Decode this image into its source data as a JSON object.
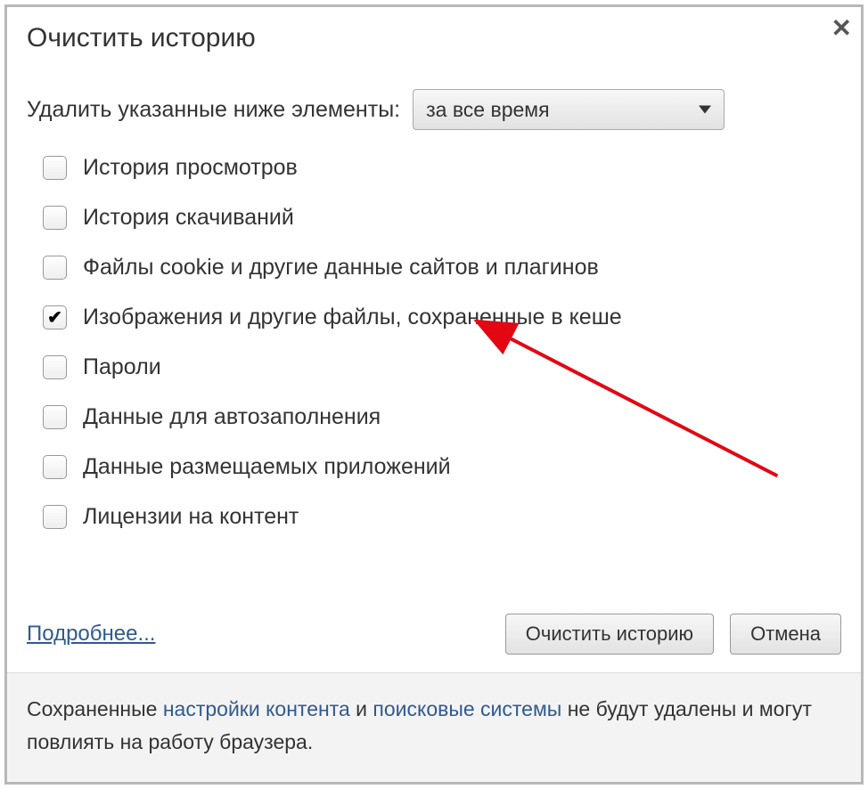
{
  "title": "Очистить историю",
  "prompt": "Удалить указанные ниже элементы:",
  "dropdown_value": "за все время",
  "options": [
    {
      "label": "История просмотров",
      "checked": false
    },
    {
      "label": "История скачиваний",
      "checked": false
    },
    {
      "label": "Файлы cookie и другие данные сайтов и плагинов",
      "checked": false
    },
    {
      "label": "Изображения и другие файлы, сохраненные в кеше",
      "checked": true
    },
    {
      "label": "Пароли",
      "checked": false
    },
    {
      "label": "Данные для автозаполнения",
      "checked": false
    },
    {
      "label": "Данные размещаемых приложений",
      "checked": false
    },
    {
      "label": "Лицензии на контент",
      "checked": false
    }
  ],
  "more_link": "Подробнее...",
  "clear_button": "Очистить историю",
  "cancel_button": "Отмена",
  "info_prefix": "Сохраненные ",
  "info_link1": "настройки контента",
  "info_mid": " и ",
  "info_link2": "поисковые системы",
  "info_suffix": " не будут удалены и могут повлиять на работу браузера."
}
